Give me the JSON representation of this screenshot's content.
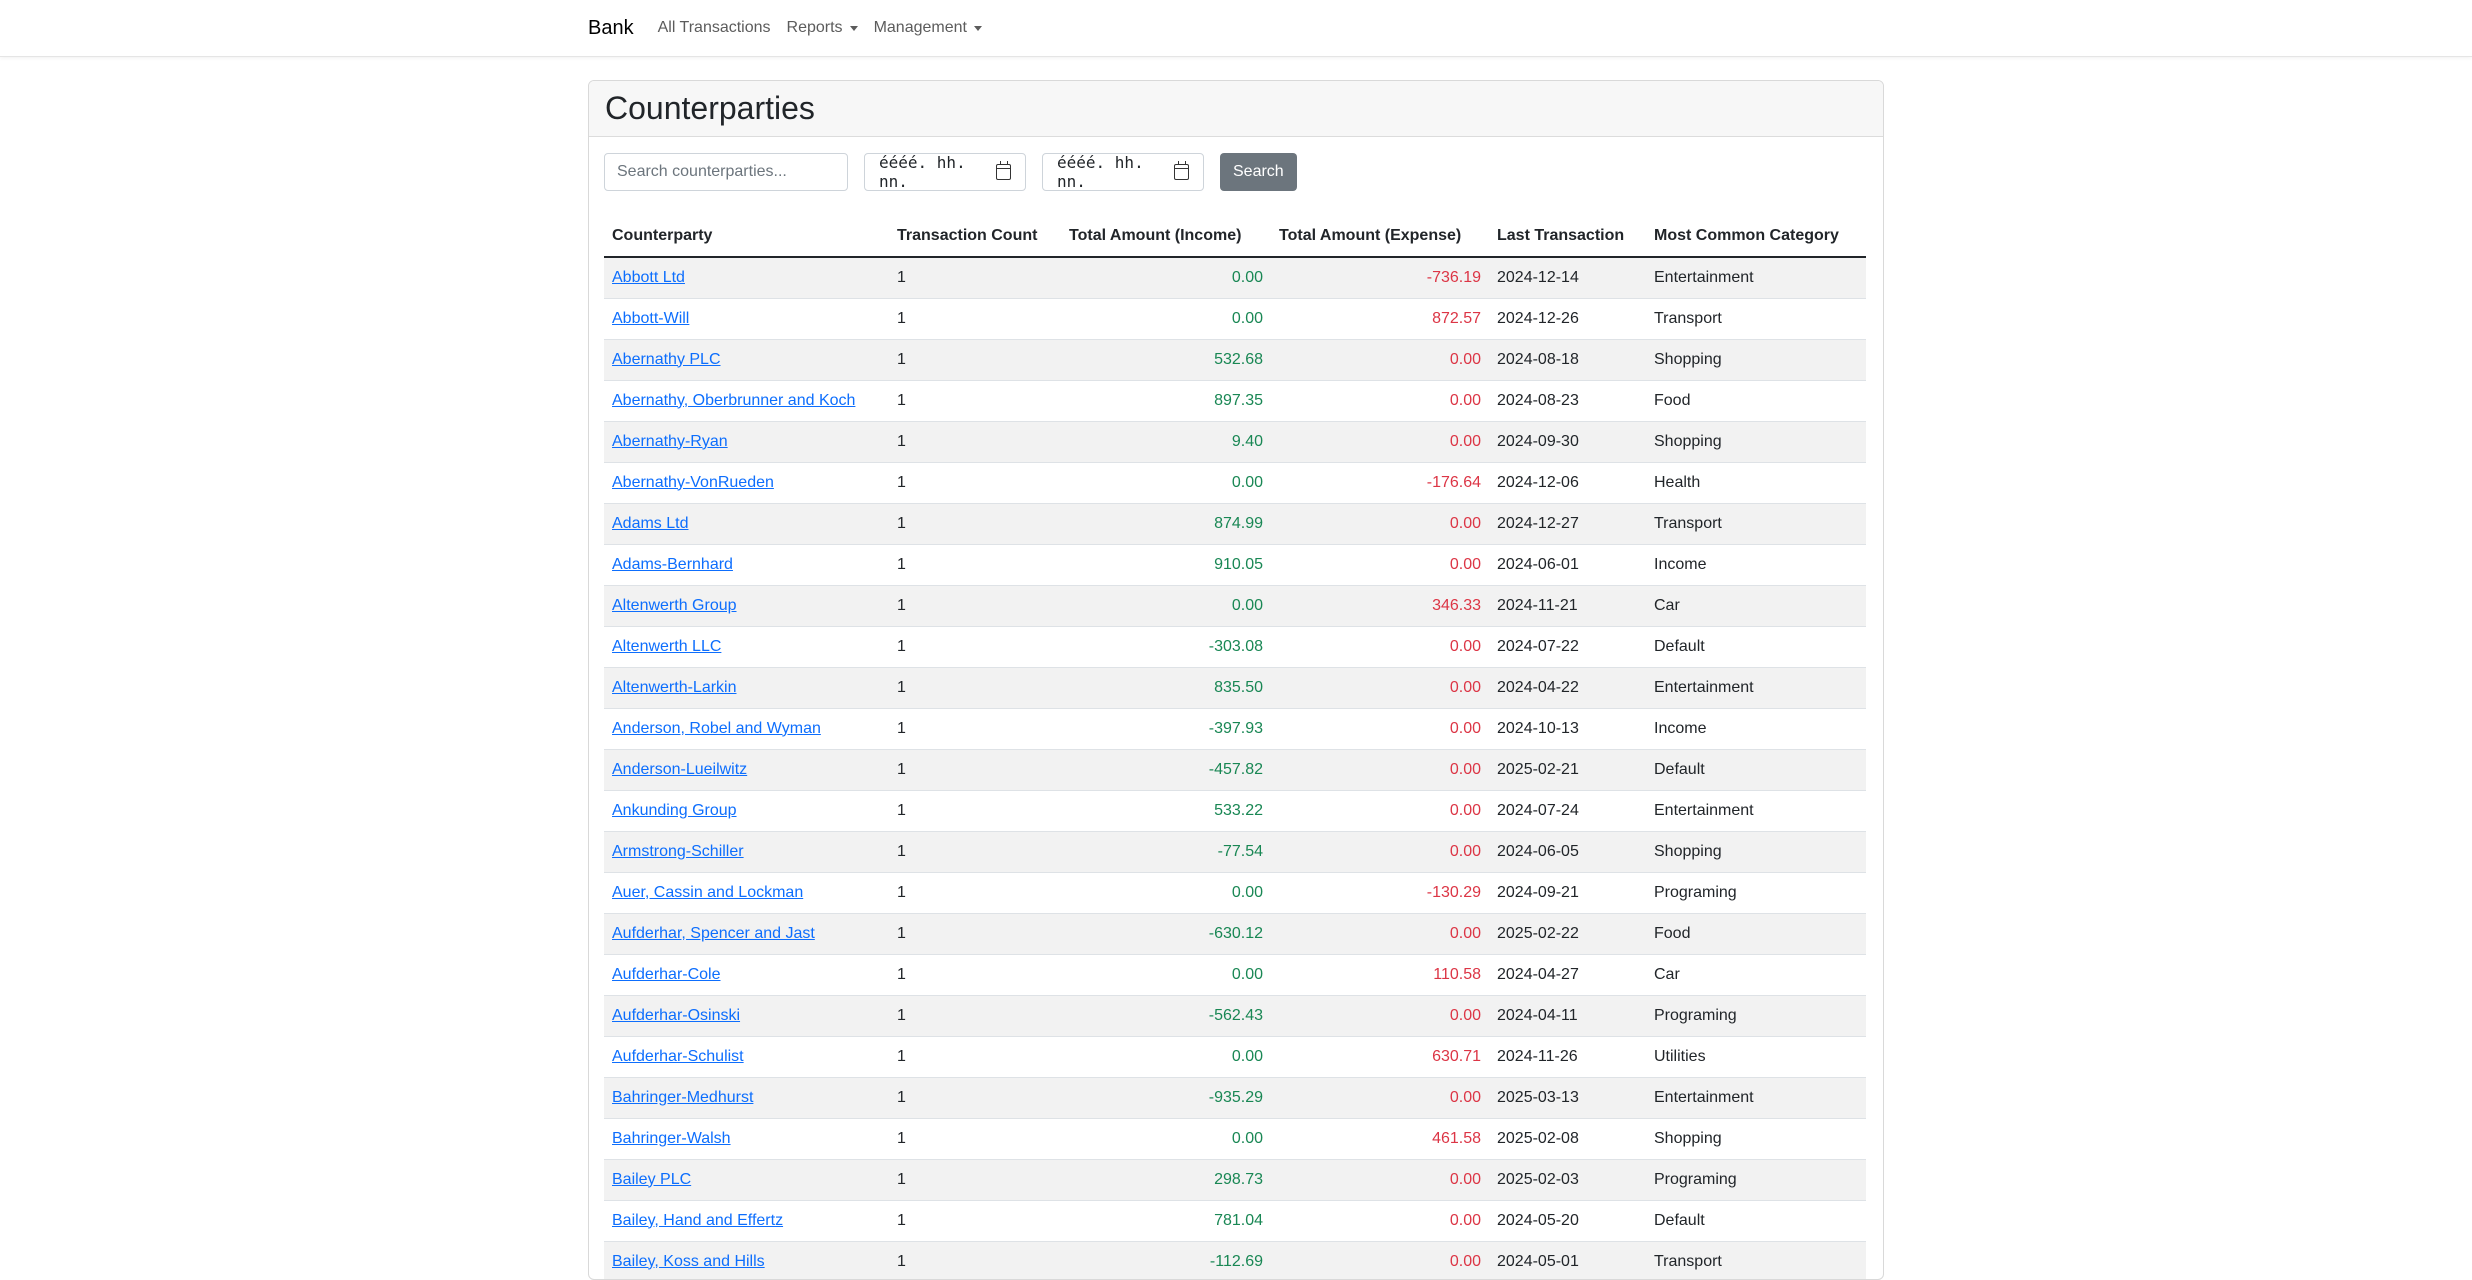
{
  "navbar": {
    "brand": "Bank",
    "links": [
      {
        "label": "All Transactions"
      },
      {
        "label": "Reports"
      },
      {
        "label": "Management"
      }
    ]
  },
  "page": {
    "title": "Counterparties"
  },
  "filters": {
    "search_placeholder": "Search counterparties...",
    "date_from_placeholder": "éééé. hh. nn.",
    "date_to_placeholder": "éééé. hh. nn.",
    "search_button": "Search"
  },
  "table": {
    "columns": [
      "Counterparty",
      "Transaction Count",
      "Total Amount (Income)",
      "Total Amount (Expense)",
      "Last Transaction",
      "Most Common Category"
    ],
    "rows": [
      {
        "name": "Abbott Ltd",
        "count": "1",
        "income": "0.00",
        "expense": "-736.19",
        "last": "2024-12-14",
        "category": "Entertainment"
      },
      {
        "name": "Abbott-Will",
        "count": "1",
        "income": "0.00",
        "expense": "872.57",
        "last": "2024-12-26",
        "category": "Transport"
      },
      {
        "name": "Abernathy PLC",
        "count": "1",
        "income": "532.68",
        "expense": "0.00",
        "last": "2024-08-18",
        "category": "Shopping"
      },
      {
        "name": "Abernathy, Oberbrunner and Koch",
        "count": "1",
        "income": "897.35",
        "expense": "0.00",
        "last": "2024-08-23",
        "category": "Food"
      },
      {
        "name": "Abernathy-Ryan",
        "count": "1",
        "income": "9.40",
        "expense": "0.00",
        "last": "2024-09-30",
        "category": "Shopping"
      },
      {
        "name": "Abernathy-VonRueden",
        "count": "1",
        "income": "0.00",
        "expense": "-176.64",
        "last": "2024-12-06",
        "category": "Health"
      },
      {
        "name": "Adams Ltd",
        "count": "1",
        "income": "874.99",
        "expense": "0.00",
        "last": "2024-12-27",
        "category": "Transport"
      },
      {
        "name": "Adams-Bernhard",
        "count": "1",
        "income": "910.05",
        "expense": "0.00",
        "last": "2024-06-01",
        "category": "Income"
      },
      {
        "name": "Altenwerth Group",
        "count": "1",
        "income": "0.00",
        "expense": "346.33",
        "last": "2024-11-21",
        "category": "Car"
      },
      {
        "name": "Altenwerth LLC",
        "count": "1",
        "income": "-303.08",
        "expense": "0.00",
        "last": "2024-07-22",
        "category": "Default"
      },
      {
        "name": "Altenwerth-Larkin",
        "count": "1",
        "income": "835.50",
        "expense": "0.00",
        "last": "2024-04-22",
        "category": "Entertainment"
      },
      {
        "name": "Anderson, Robel and Wyman",
        "count": "1",
        "income": "-397.93",
        "expense": "0.00",
        "last": "2024-10-13",
        "category": "Income"
      },
      {
        "name": "Anderson-Lueilwitz",
        "count": "1",
        "income": "-457.82",
        "expense": "0.00",
        "last": "2025-02-21",
        "category": "Default"
      },
      {
        "name": "Ankunding Group",
        "count": "1",
        "income": "533.22",
        "expense": "0.00",
        "last": "2024-07-24",
        "category": "Entertainment"
      },
      {
        "name": "Armstrong-Schiller",
        "count": "1",
        "income": "-77.54",
        "expense": "0.00",
        "last": "2024-06-05",
        "category": "Shopping"
      },
      {
        "name": "Auer, Cassin and Lockman",
        "count": "1",
        "income": "0.00",
        "expense": "-130.29",
        "last": "2024-09-21",
        "category": "Programing"
      },
      {
        "name": "Aufderhar, Spencer and Jast",
        "count": "1",
        "income": "-630.12",
        "expense": "0.00",
        "last": "2025-02-22",
        "category": "Food"
      },
      {
        "name": "Aufderhar-Cole",
        "count": "1",
        "income": "0.00",
        "expense": "110.58",
        "last": "2024-04-27",
        "category": "Car"
      },
      {
        "name": "Aufderhar-Osinski",
        "count": "1",
        "income": "-562.43",
        "expense": "0.00",
        "last": "2024-04-11",
        "category": "Programing"
      },
      {
        "name": "Aufderhar-Schulist",
        "count": "1",
        "income": "0.00",
        "expense": "630.71",
        "last": "2024-11-26",
        "category": "Utilities"
      },
      {
        "name": "Bahringer-Medhurst",
        "count": "1",
        "income": "-935.29",
        "expense": "0.00",
        "last": "2025-03-13",
        "category": "Entertainment"
      },
      {
        "name": "Bahringer-Walsh",
        "count": "1",
        "income": "0.00",
        "expense": "461.58",
        "last": "2025-02-08",
        "category": "Shopping"
      },
      {
        "name": "Bailey PLC",
        "count": "1",
        "income": "298.73",
        "expense": "0.00",
        "last": "2025-02-03",
        "category": "Programing"
      },
      {
        "name": "Bailey, Hand and Effertz",
        "count": "1",
        "income": "781.04",
        "expense": "0.00",
        "last": "2024-05-20",
        "category": "Default"
      },
      {
        "name": "Bailey, Koss and Hills",
        "count": "1",
        "income": "-112.69",
        "expense": "0.00",
        "last": "2024-05-01",
        "category": "Transport"
      }
    ]
  }
}
